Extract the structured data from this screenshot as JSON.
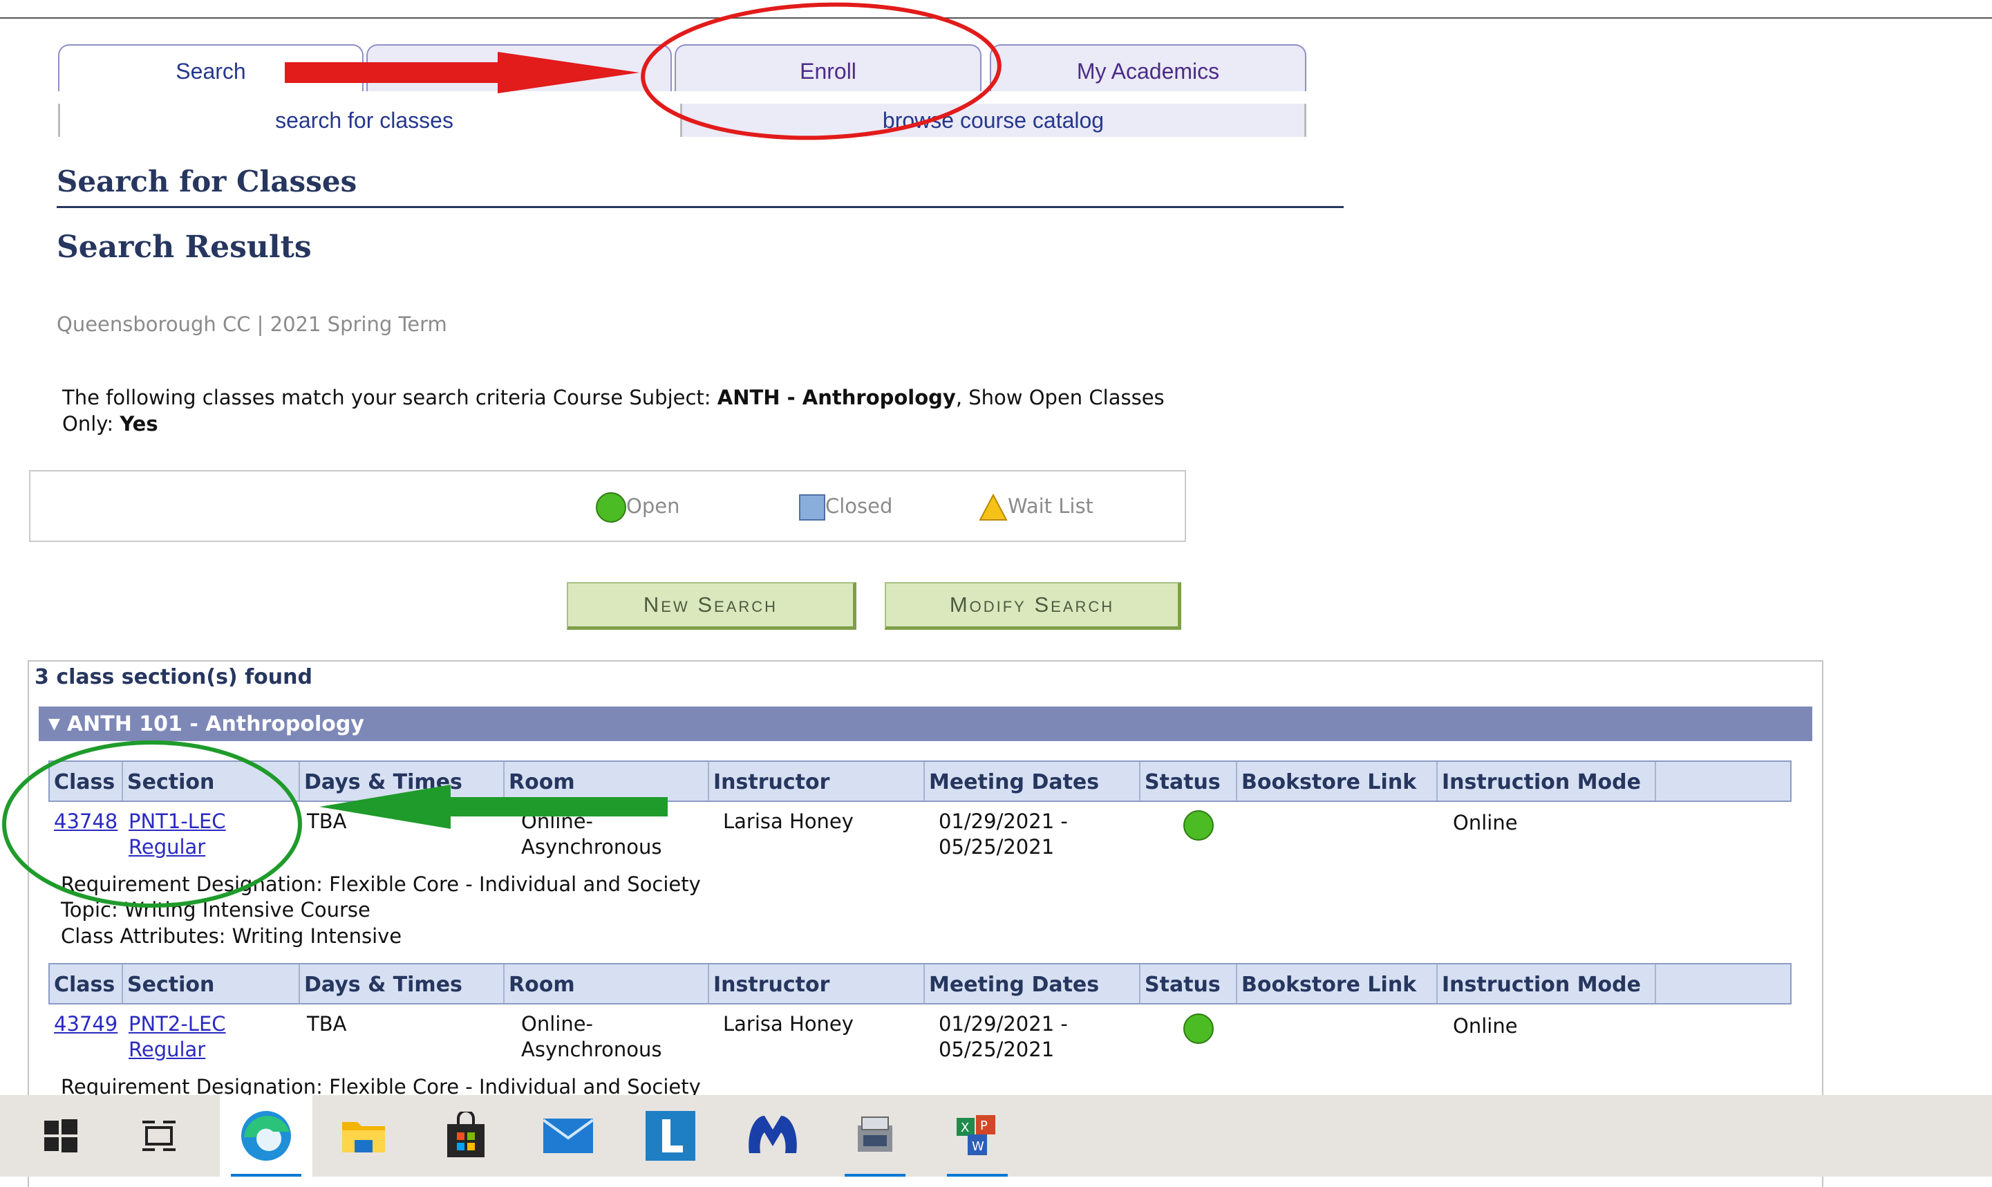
{
  "tabs": [
    {
      "label": "Search"
    },
    {
      "label": "Enroll"
    },
    {
      "label": "My Academics"
    }
  ],
  "subtabs": [
    {
      "label": "search for classes"
    },
    {
      "label": "browse course catalog"
    }
  ],
  "page_title": "Search for Classes",
  "section_title": "Search Results",
  "term": "Queensborough CC | 2021 Spring Term",
  "criteria": {
    "prefix": "The following classes match your search criteria Course Subject: ",
    "subject": "ANTH - Anthropology",
    "mid": ",  Show Open Classes Only: ",
    "open_only": "Yes"
  },
  "legend": {
    "open": "Open",
    "closed": "Closed",
    "waitlist": "Wait List"
  },
  "buttons": {
    "new_search": "New Search",
    "modify_search": "Modify Search"
  },
  "results": {
    "count_text": "3 class section(s) found",
    "group_title": "ANTH 101 - Anthropology",
    "columns": [
      "Class",
      "Section",
      "Days & Times",
      "Room",
      "Instructor",
      "Meeting Dates",
      "Status",
      "Bookstore Link",
      "Instruction Mode"
    ],
    "rows": [
      {
        "class_nbr": "43748",
        "section": "PNT1-LEC",
        "session": "Regular",
        "days_times": "TBA",
        "room_line1": "Online-",
        "room_line2": "Asynchronous",
        "instructor": "Larisa Honey",
        "dates_line1": "01/29/2021 -",
        "dates_line2": "05/25/2021",
        "status": "open",
        "mode": "Online",
        "requirement": "Requirement Designation: Flexible Core - Individual and Society",
        "topic": "Topic: Writing Intensive Course",
        "attributes": "Class Attributes: Writing Intensive"
      },
      {
        "class_nbr": "43749",
        "section": "PNT2-LEC",
        "session": "Regular",
        "days_times": "TBA",
        "room_line1": "Online-",
        "room_line2": "Asynchronous",
        "instructor": "Larisa Honey",
        "dates_line1": "01/29/2021 -",
        "dates_line2": "05/25/2021",
        "status": "open",
        "mode": "Online",
        "requirement": "Requirement Designation: Flexible Core - Individual and Society"
      }
    ]
  },
  "taskbar": [
    "windows-start",
    "task-view",
    "edge",
    "file-explorer",
    "microsoft-store",
    "mail",
    "l-app",
    "malwarebytes",
    "scanner-app",
    "office-app"
  ],
  "colors": {
    "tab_bg": "#ebeaf7",
    "header_row": "#d6e0f2",
    "group_bar": "#7d88b7",
    "button_bg": "#dbe8bd",
    "status_open": "#4cbc24",
    "annotation_red": "#e21b1b",
    "annotation_green": "#1f9b2b"
  }
}
